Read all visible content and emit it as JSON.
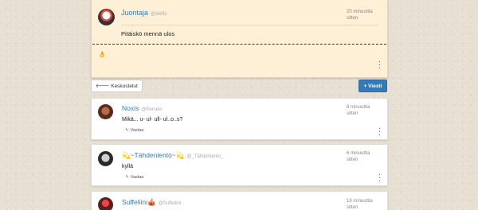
{
  "op": {
    "name": "Juontaja",
    "handle": "@Idefix",
    "time": "20 minuuttia sitten",
    "body": "Pitäiskö mennä ulos",
    "emoji": "👌"
  },
  "toolbar": {
    "back_label": "🡐 Keskustelut",
    "new_label": "+ Viesti"
  },
  "replies": [
    {
      "name": "Noxis",
      "handle": "@Persein",
      "time": "8 minuuttia sitten",
      "text": "Mikä... u- ul- ull- ul..o..s?",
      "reply": "Vastaa"
    },
    {
      "name": "💫~Tähdenlento~💫",
      "handle": "@_Tähdenlento_",
      "time": "6 minuuttia sitten",
      "text": "kyllä",
      "reply": "Vastaa"
    },
    {
      "name": "Suffeliini🎪",
      "handle": "@Suffeliini",
      "time": "18 minuuttia sitten",
      "text": "",
      "reply": ""
    }
  ],
  "icons": {
    "reply": "reply-arrow-icon",
    "more": "vertical-dots-icon"
  }
}
